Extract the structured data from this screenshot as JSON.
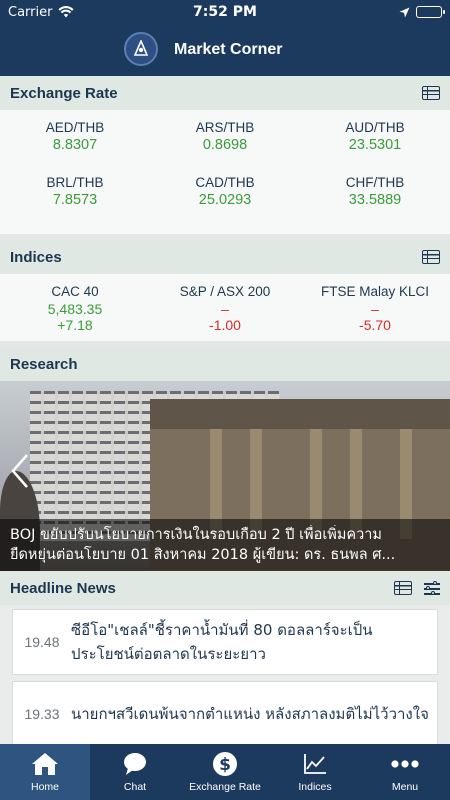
{
  "status": {
    "carrier": "Carrier",
    "time": "7:52 PM"
  },
  "header": {
    "title": "Market Corner"
  },
  "exchange": {
    "title": "Exchange Rate",
    "rates": [
      {
        "pair": "AED/THB",
        "value": "8.8307"
      },
      {
        "pair": "ARS/THB",
        "value": "0.8698"
      },
      {
        "pair": "AUD/THB",
        "value": "23.5301"
      },
      {
        "pair": "BRL/THB",
        "value": "7.8573"
      },
      {
        "pair": "CAD/THB",
        "value": "25.0293"
      },
      {
        "pair": "CHF/THB",
        "value": "33.5889"
      }
    ]
  },
  "indices": {
    "title": "Indices",
    "items": [
      {
        "name": "CAC 40",
        "value": "5,483.35",
        "change": "+7.18"
      },
      {
        "name": "S&P / ASX 200",
        "value": "–",
        "change": "-1.00"
      },
      {
        "name": "FTSE Malay KLCI",
        "value": "–",
        "change": "-5.70"
      }
    ]
  },
  "research": {
    "title": "Research",
    "caption_line1": "BOJ ขยับปรับนโยบายการเงินในรอบเกือบ 2 ปี เพื่อเพิ่มความ",
    "caption_line2": "ยืดหยุ่นต่อนโยบาย 01 สิงหาคม 2018 ผู้เขียน: ดร. ธนพล ศ..."
  },
  "news": {
    "title": "Headline News",
    "items": [
      {
        "time": "19.48",
        "text": "ซีอีโอ\"เชลล์\"ชี้ราคาน้ำมันที่ 80 ดอลลาร์จะเป็นประโยชน์ต่อตลาดในระยะยาว"
      },
      {
        "time": "19.33",
        "text": "นายกฯสวีเดนพ้นจากตำแหน่ง หลังสภาลงมติไม่ไว้วางใจ"
      }
    ]
  },
  "tabs": [
    {
      "label": "Home",
      "icon": "home-icon"
    },
    {
      "label": "Chat",
      "icon": "chat-icon"
    },
    {
      "label": "Exchange Rate",
      "icon": "dollar-icon"
    },
    {
      "label": "Indices",
      "icon": "chart-icon"
    },
    {
      "label": "Menu",
      "icon": "more-icon"
    }
  ],
  "colors": {
    "navy": "#1c3a5e",
    "positive": "#3a9b3a",
    "negative": "#d42b2b",
    "section_bg": "#dfe8e3"
  }
}
